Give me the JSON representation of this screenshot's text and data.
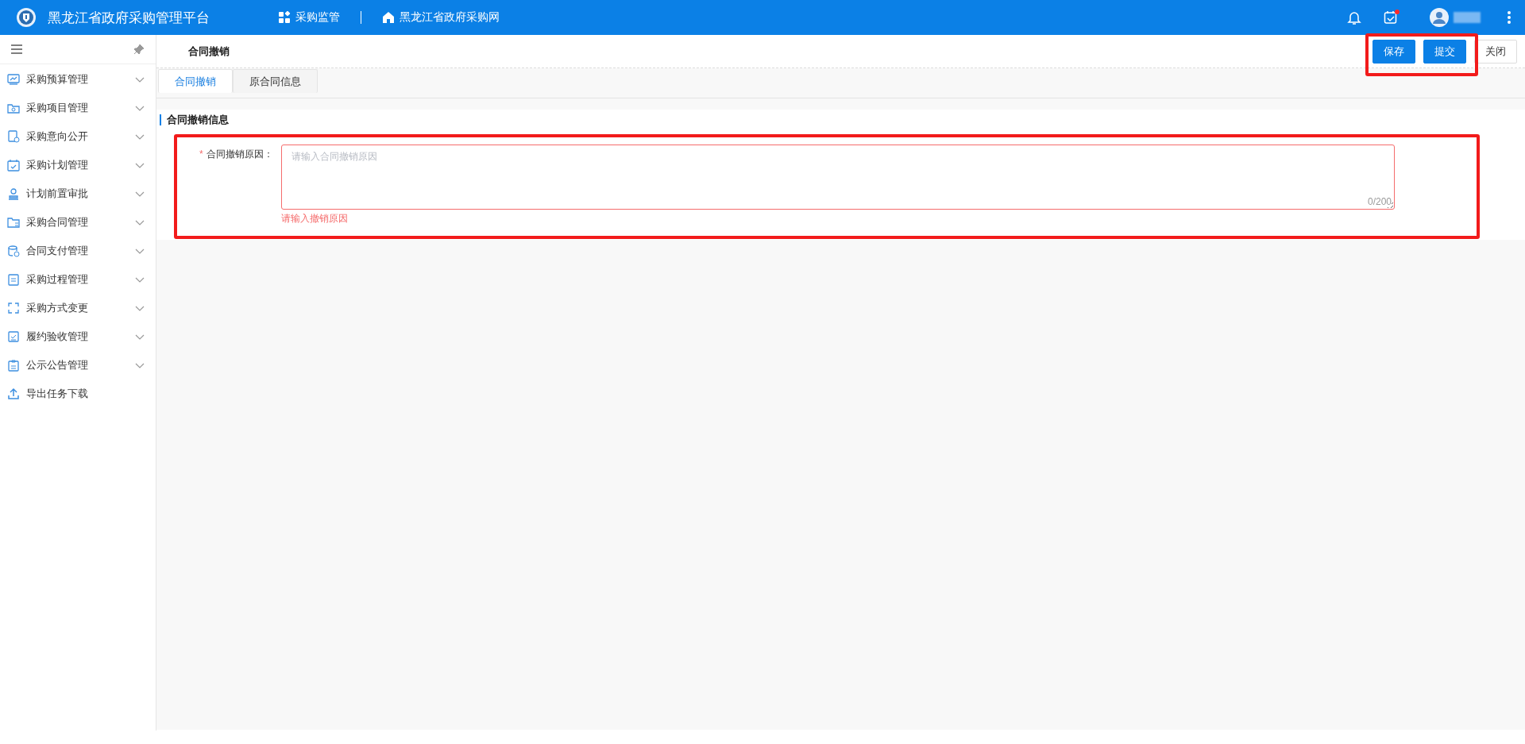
{
  "header": {
    "title": "黑龙江省政府采购管理平台",
    "nav": [
      {
        "label": "采购监管",
        "kind": "apps"
      },
      {
        "label": "黑龙江省政府采购网",
        "kind": "home"
      }
    ],
    "task_badge": true
  },
  "sidebar": {
    "items": [
      {
        "label": "采购预算管理",
        "expandable": true
      },
      {
        "label": "采购项目管理",
        "expandable": true
      },
      {
        "label": "采购意向公开",
        "expandable": true
      },
      {
        "label": "采购计划管理",
        "expandable": true
      },
      {
        "label": "计划前置审批",
        "expandable": true
      },
      {
        "label": "采购合同管理",
        "expandable": true
      },
      {
        "label": "合同支付管理",
        "expandable": true
      },
      {
        "label": "采购过程管理",
        "expandable": true
      },
      {
        "label": "采购方式变更",
        "expandable": true
      },
      {
        "label": "履约验收管理",
        "expandable": true
      },
      {
        "label": "公示公告管理",
        "expandable": true
      },
      {
        "label": "导出任务下载",
        "expandable": false
      }
    ]
  },
  "page": {
    "title": "合同撤销",
    "buttons": [
      {
        "label": "保存",
        "kind": "primary"
      },
      {
        "label": "提交",
        "kind": "primary"
      },
      {
        "label": "关闭",
        "kind": "default"
      }
    ],
    "tabs": [
      {
        "label": "合同撤销",
        "selected": true
      },
      {
        "label": "原合同信息",
        "selected": false
      }
    ],
    "section_title": "合同撤销信息",
    "form": {
      "label": "合同撤销原因：",
      "required": true,
      "required_mark": "*",
      "placeholder": "请输入合同撤销原因",
      "counter": "0/200",
      "error": "请输入撤销原因"
    }
  }
}
